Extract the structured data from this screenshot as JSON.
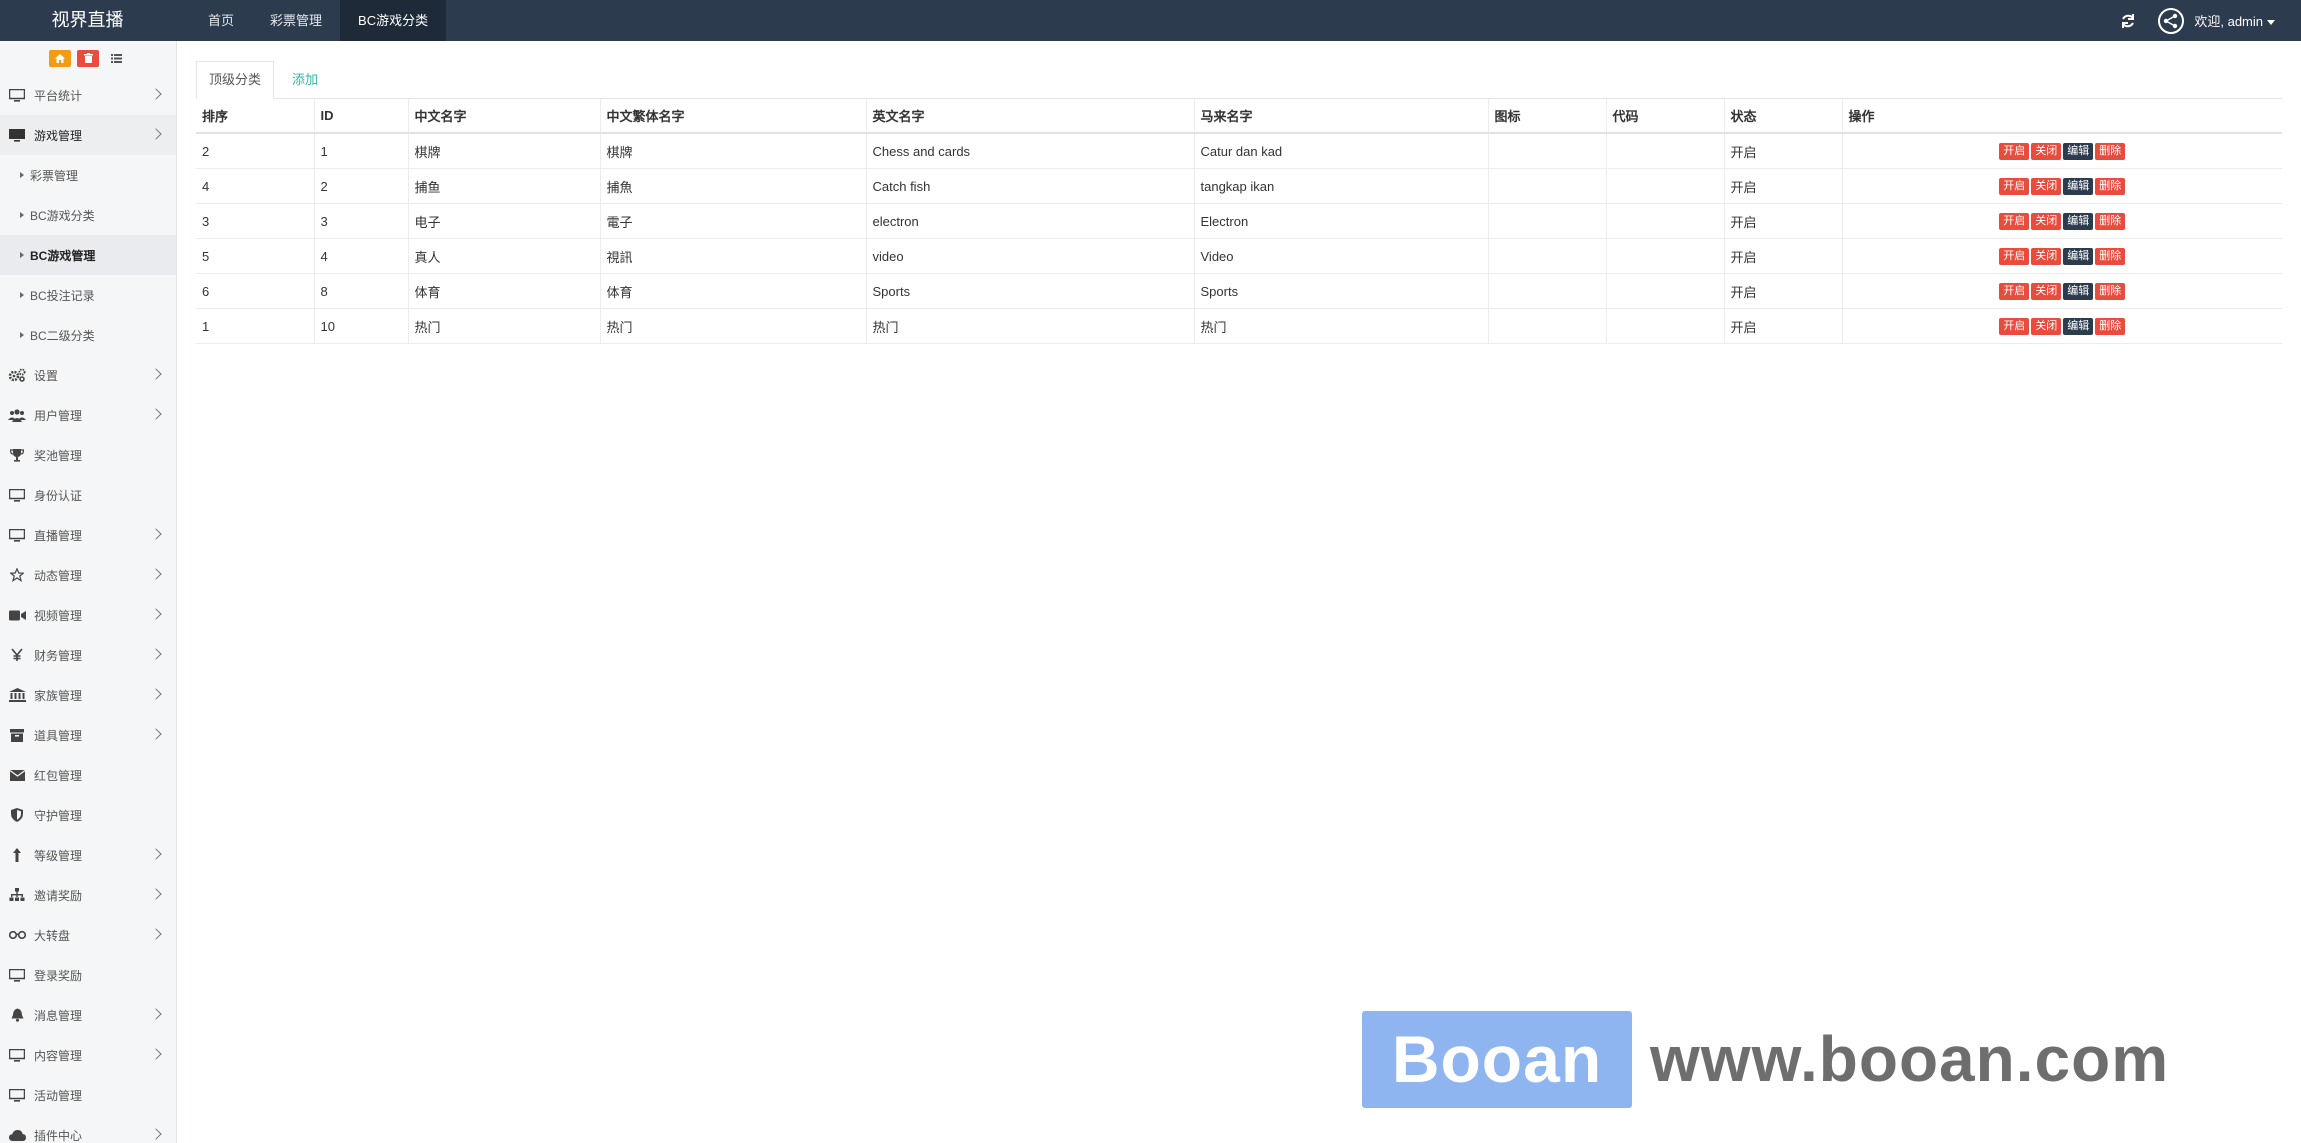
{
  "app": {
    "brand": "视界直播"
  },
  "topnav": {
    "tabs": [
      {
        "label": "首页",
        "active": false
      },
      {
        "label": "彩票管理",
        "active": false
      },
      {
        "label": "BC游戏分类",
        "active": true
      }
    ],
    "welcome": "欢迎, admin"
  },
  "sidebar": {
    "menu_before": [
      {
        "label": "平台统计",
        "icon": "monitor-icon",
        "has_children": true
      }
    ],
    "open_menu": {
      "label": "游戏管理",
      "icon": "monitor-icon",
      "has_children": true
    },
    "sub_items": [
      {
        "label": "彩票管理",
        "active": false
      },
      {
        "label": "BC游戏分类",
        "active": false
      },
      {
        "label": "BC游戏管理",
        "active": true
      },
      {
        "label": "BC投注记录",
        "active": false
      },
      {
        "label": "BC二级分类",
        "active": false
      }
    ],
    "menu_after": [
      {
        "label": "设置",
        "icon": "gears-icon",
        "has_children": true
      },
      {
        "label": "用户管理",
        "icon": "users-icon",
        "has_children": true
      },
      {
        "label": "奖池管理",
        "icon": "trophy-icon",
        "has_children": false
      },
      {
        "label": "身份认证",
        "icon": "monitor-icon",
        "has_children": false
      },
      {
        "label": "直播管理",
        "icon": "monitor-icon",
        "has_children": true
      },
      {
        "label": "动态管理",
        "icon": "star-icon",
        "has_children": true
      },
      {
        "label": "视频管理",
        "icon": "video-icon",
        "has_children": true
      },
      {
        "label": "财务管理",
        "icon": "yen-icon",
        "has_children": true
      },
      {
        "label": "家族管理",
        "icon": "bank-icon",
        "has_children": true
      },
      {
        "label": "道具管理",
        "icon": "box-icon",
        "has_children": true
      },
      {
        "label": "红包管理",
        "icon": "envelope-icon",
        "has_children": false
      },
      {
        "label": "守护管理",
        "icon": "shield-icon",
        "has_children": false
      },
      {
        "label": "等级管理",
        "icon": "level-icon",
        "has_children": true
      },
      {
        "label": "邀请奖励",
        "icon": "sitemap-icon",
        "has_children": true
      },
      {
        "label": "大转盘",
        "icon": "glasses-icon",
        "has_children": true
      },
      {
        "label": "登录奖励",
        "icon": "monitor-icon",
        "has_children": false
      },
      {
        "label": "消息管理",
        "icon": "bell-icon",
        "has_children": true
      },
      {
        "label": "内容管理",
        "icon": "monitor-icon",
        "has_children": true
      },
      {
        "label": "活动管理",
        "icon": "monitor-icon",
        "has_children": false
      },
      {
        "label": "插件中心",
        "icon": "cloud-icon",
        "has_children": true
      }
    ]
  },
  "content": {
    "tabs": [
      {
        "label": "顶级分类",
        "active": true
      },
      {
        "label": "添加",
        "active": false
      }
    ],
    "table": {
      "columns": [
        "排序",
        "ID",
        "中文名字",
        "中文繁体名字",
        "英文名字",
        "马来名字",
        "图标",
        "代码",
        "状态",
        "操作"
      ],
      "rows": [
        [
          "2",
          "1",
          "棋牌",
          "棋牌",
          "Chess and cards",
          "Catur dan kad",
          "",
          "",
          "开启"
        ],
        [
          "4",
          "2",
          "捕鱼",
          "捕魚",
          "Catch fish",
          "tangkap ikan",
          "",
          "",
          "开启"
        ],
        [
          "3",
          "3",
          "电子",
          "電子",
          "electron",
          "Electron",
          "",
          "",
          "开启"
        ],
        [
          "5",
          "4",
          "真人",
          "視訊",
          "video",
          "Video",
          "",
          "",
          "开启"
        ],
        [
          "6",
          "8",
          "体育",
          "体育",
          "Sports",
          "Sports",
          "",
          "",
          "开启"
        ],
        [
          "1",
          "10",
          "热门",
          "热门",
          "热门",
          "热门",
          "",
          "",
          "开启"
        ]
      ],
      "actions": [
        {
          "label": "开启",
          "style": "red"
        },
        {
          "label": "关闭",
          "style": "red"
        },
        {
          "label": "编辑",
          "style": "dark"
        },
        {
          "label": "删除",
          "style": "red"
        }
      ]
    }
  },
  "watermark": {
    "box": "Booan",
    "text": "www.booan.com"
  },
  "colors": {
    "topbar": "#2c3b4e",
    "danger": "#e74c3c",
    "accent": "#2fb5a8",
    "warning": "#f39c12"
  }
}
